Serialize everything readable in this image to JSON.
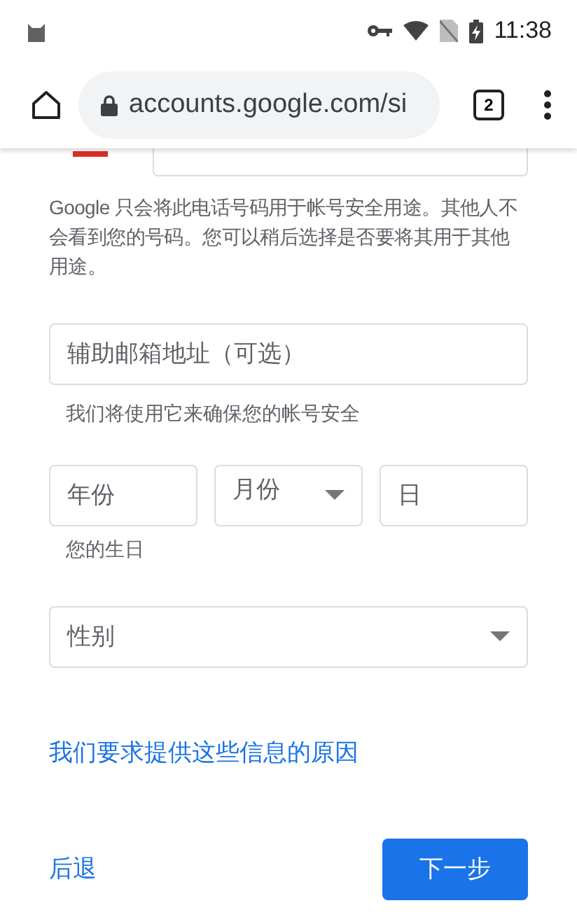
{
  "status_bar": {
    "time": "11:38"
  },
  "browser": {
    "url": "accounts.google.com/si",
    "tab_count": "2"
  },
  "form": {
    "phone_note": "Google 只会将此电话号码用于帐号安全用途。其他人不会看到您的号码。您可以稍后选择是否要将其用于其他用途。",
    "recovery_email": {
      "placeholder": "辅助邮箱地址（可选）",
      "hint": "我们将使用它来确保您的帐号安全"
    },
    "birthday": {
      "fields": [
        {
          "kind": "text",
          "placeholder": "年份"
        },
        {
          "kind": "select",
          "placeholder": "月份"
        },
        {
          "kind": "text",
          "placeholder": "日"
        }
      ],
      "hint": "您的生日"
    },
    "gender": {
      "placeholder": "性别"
    },
    "reason_link": "我们要求提供这些信息的原因",
    "back": "后退",
    "next": "下一步"
  }
}
